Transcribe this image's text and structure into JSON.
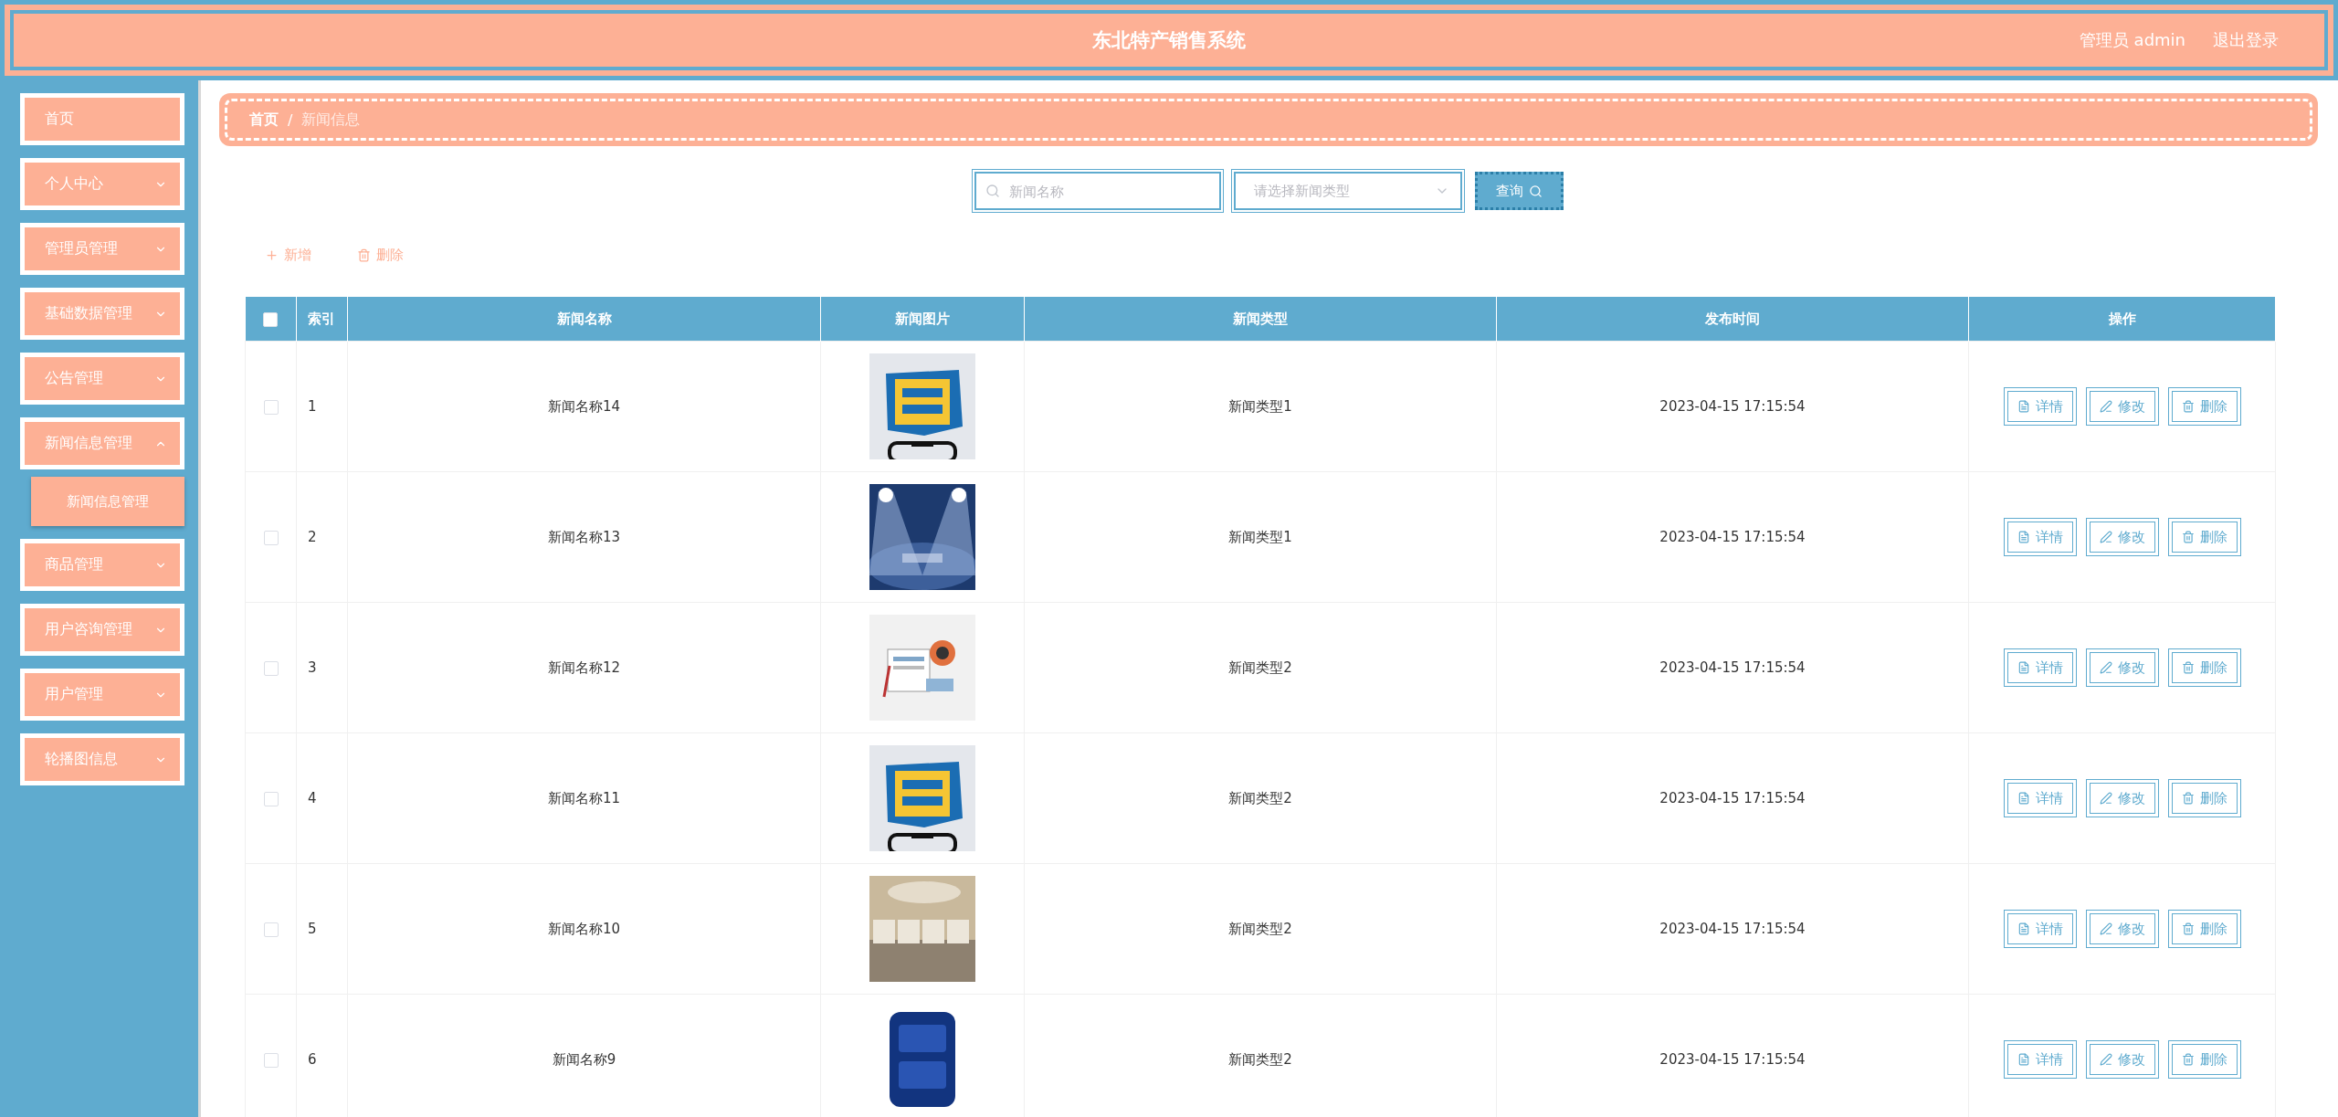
{
  "header": {
    "title": "东北特产销售系统",
    "user": "管理员 admin",
    "logout": "退出登录"
  },
  "sidebar": {
    "items": [
      {
        "label": "首页",
        "expandable": false
      },
      {
        "label": "个人中心",
        "expandable": true,
        "expanded": false
      },
      {
        "label": "管理员管理",
        "expandable": true,
        "expanded": false
      },
      {
        "label": "基础数据管理",
        "expandable": true,
        "expanded": false
      },
      {
        "label": "公告管理",
        "expandable": true,
        "expanded": false
      },
      {
        "label": "新闻信息管理",
        "expandable": true,
        "expanded": true,
        "children": [
          {
            "label": "新闻信息管理"
          }
        ]
      },
      {
        "label": "商品管理",
        "expandable": true,
        "expanded": false
      },
      {
        "label": "用户咨询管理",
        "expandable": true,
        "expanded": false
      },
      {
        "label": "用户管理",
        "expandable": true,
        "expanded": false
      },
      {
        "label": "轮播图信息",
        "expandable": true,
        "expanded": false
      }
    ]
  },
  "breadcrumb": [
    "首页",
    "新闻信息"
  ],
  "breadcrumb_separator": "/",
  "search": {
    "name_placeholder": "新闻名称",
    "type_placeholder": "请选择新闻类型",
    "button": "查询"
  },
  "actions": [
    "新增",
    "删除"
  ],
  "table": {
    "all_checked": false,
    "columns": [
      "索引",
      "新闻名称",
      "新闻图片",
      "新闻类型",
      "发布时间",
      "操作"
    ],
    "rows": [
      {
        "checked": false,
        "index": "1",
        "name": "新闻名称14",
        "type": "新闻类型1",
        "time": "2023-04-15 17:15:54",
        "ops": [
          "详情",
          "修改",
          "删除"
        ]
      },
      {
        "checked": false,
        "index": "2",
        "name": "新闻名称13",
        "type": "新闻类型1",
        "time": "2023-04-15 17:15:54",
        "ops": [
          "详情",
          "修改",
          "删除"
        ]
      },
      {
        "checked": false,
        "index": "3",
        "name": "新闻名称12",
        "type": "新闻类型2",
        "time": "2023-04-15 17:15:54",
        "ops": [
          "详情",
          "修改",
          "删除"
        ]
      },
      {
        "checked": false,
        "index": "4",
        "name": "新闻名称11",
        "type": "新闻类型2",
        "time": "2023-04-15 17:15:54",
        "ops": [
          "详情",
          "修改",
          "删除"
        ]
      },
      {
        "checked": false,
        "index": "5",
        "name": "新闻名称10",
        "type": "新闻类型2",
        "time": "2023-04-15 17:15:54",
        "ops": [
          "详情",
          "修改",
          "删除"
        ]
      },
      {
        "checked": false,
        "index": "6",
        "name": "新闻名称9",
        "type": "新闻类型2",
        "time": "2023-04-15 17:15:54",
        "ops": [
          "详情",
          "修改",
          "删除"
        ]
      }
    ]
  }
}
